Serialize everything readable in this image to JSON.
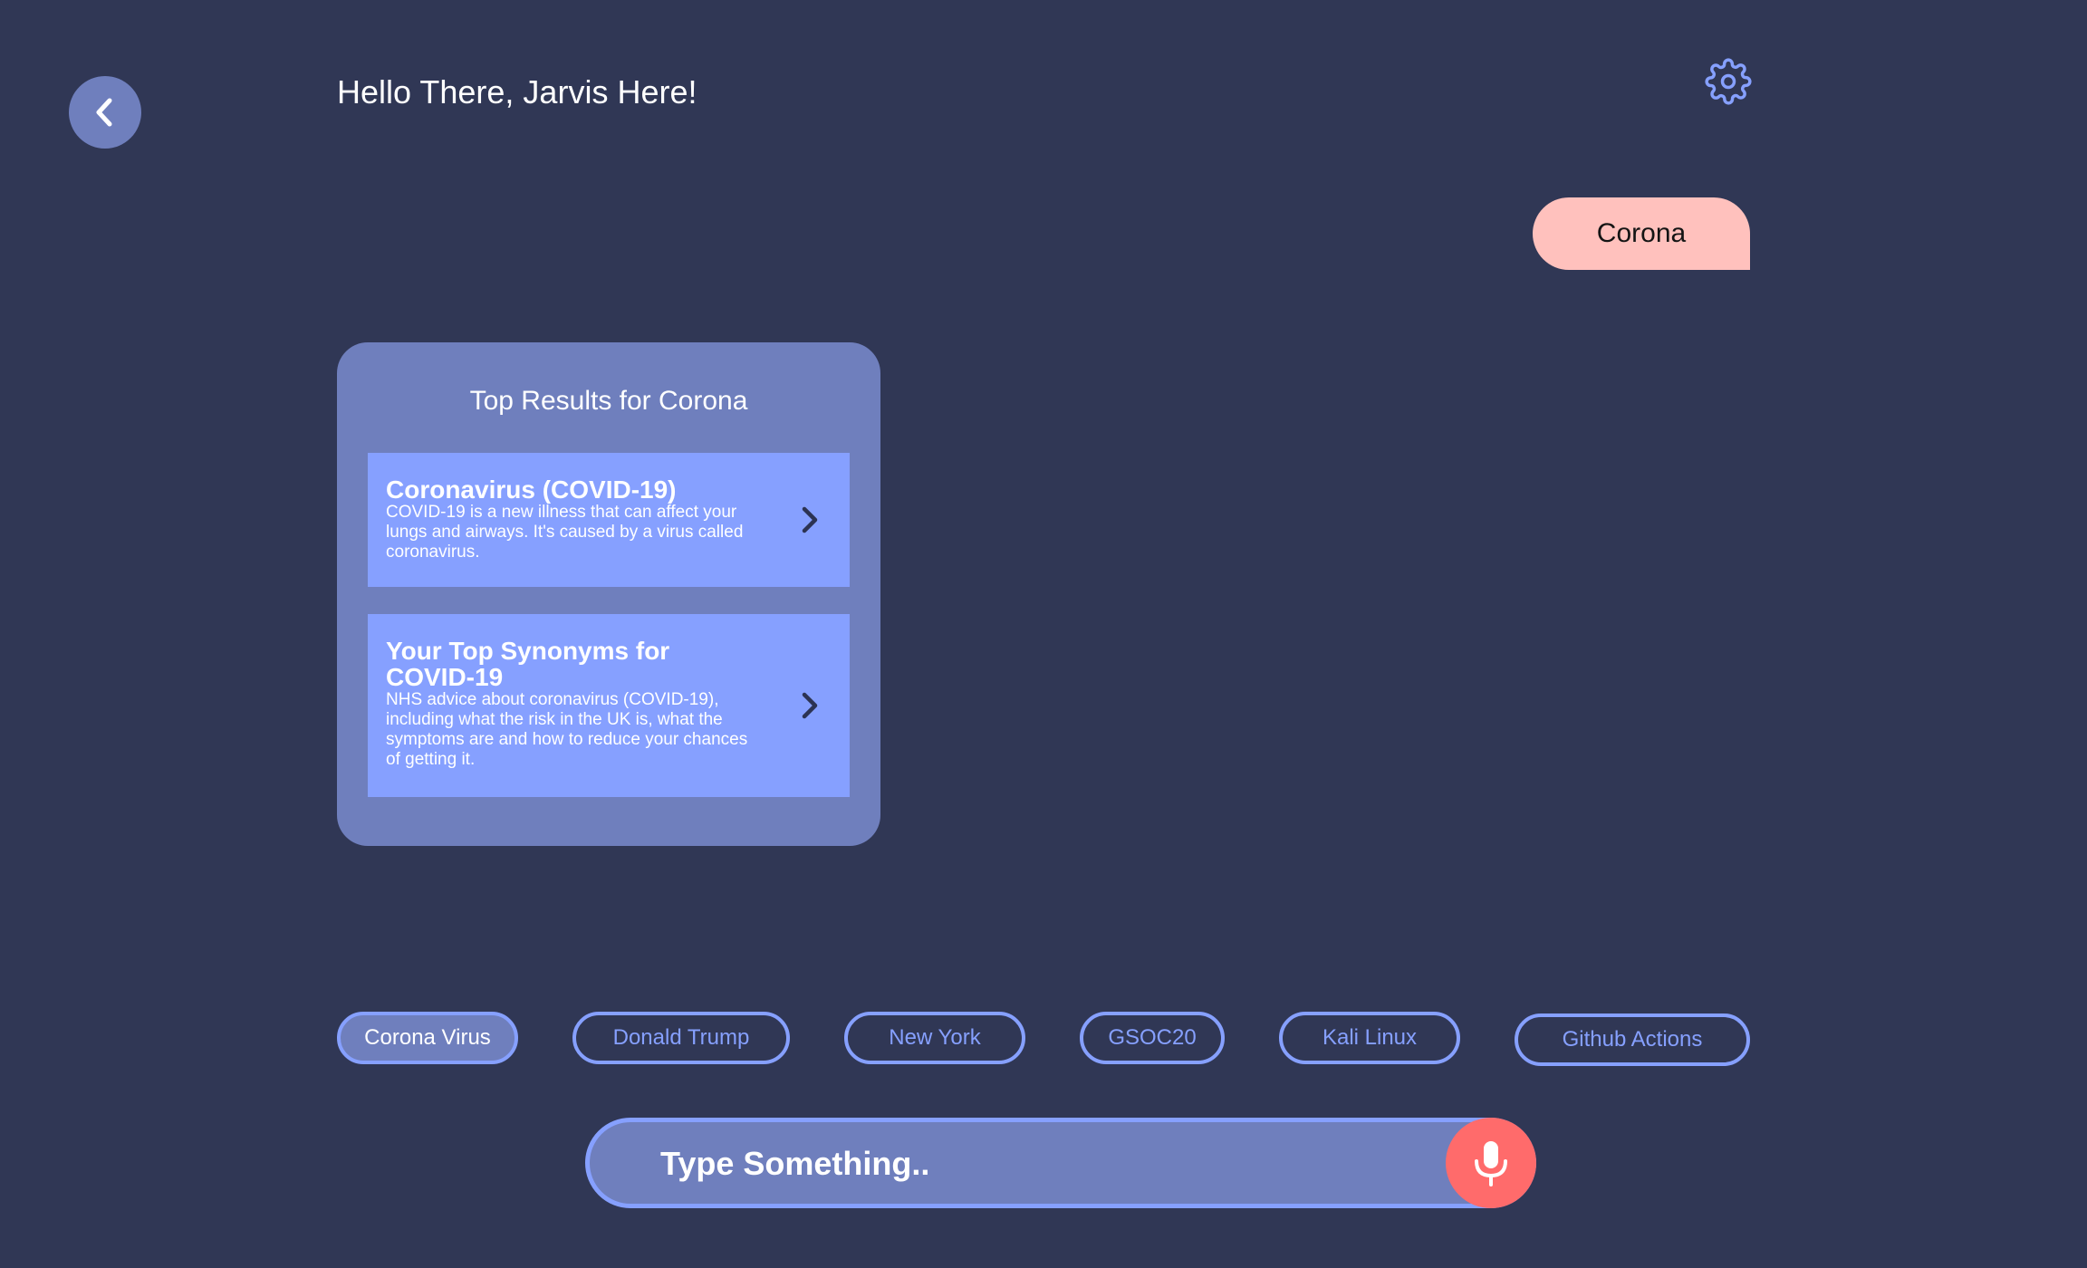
{
  "header": {
    "greeting": "Hello There, Jarvis Here!",
    "back_icon": "chevron-left-icon",
    "settings_icon": "gear-icon"
  },
  "chat": {
    "user_message": "Corona"
  },
  "results": {
    "title": "Top Results for Corona",
    "items": [
      {
        "title": "Coronavirus (COVID-19)",
        "description": "COVID-19 is a new illness that can affect your lungs and airways. It's caused by a virus called coronavirus.",
        "icon": "chevron-right-icon"
      },
      {
        "title": "Your Top Synonyms for COVID-19",
        "description": "NHS advice about coronavirus (COVID-19), including what the risk in the UK is, what the symptoms are and how to reduce your chances of getting it.",
        "icon": "chevron-right-icon"
      }
    ]
  },
  "suggestions": [
    {
      "label": "Corona Virus",
      "active": true
    },
    {
      "label": "Donald Trump",
      "active": false
    },
    {
      "label": "New York",
      "active": false
    },
    {
      "label": "GSOC20",
      "active": false
    },
    {
      "label": "Kali Linux",
      "active": false
    },
    {
      "label": "Github Actions",
      "active": false
    }
  ],
  "input": {
    "placeholder": "Type Something..",
    "value": "",
    "mic_icon": "microphone-icon"
  },
  "colors": {
    "background": "#303755",
    "card": "#6f7fbd",
    "accent": "#86a0ff",
    "user_bubble": "#ffc1bd",
    "mic": "#ff6b6b"
  }
}
